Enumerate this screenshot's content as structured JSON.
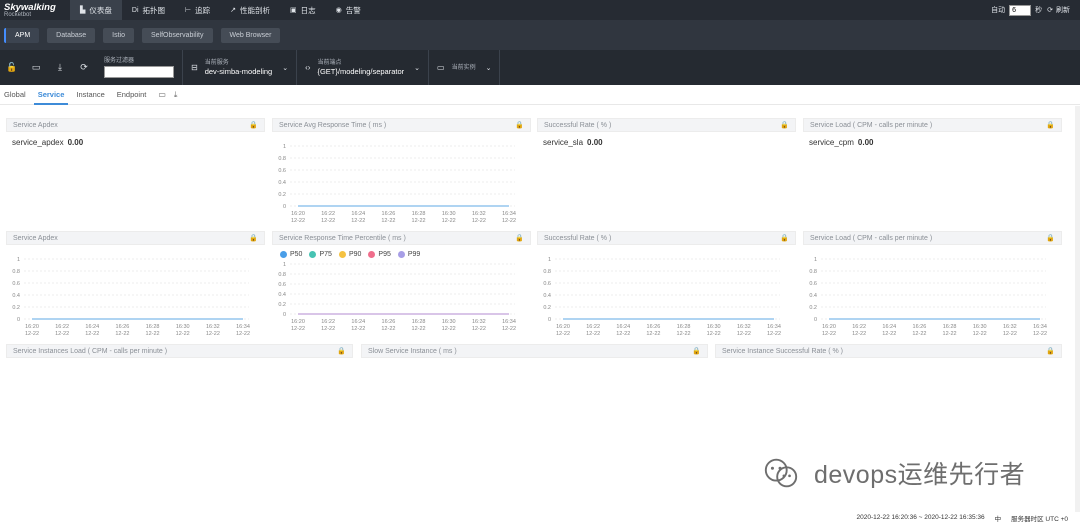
{
  "logo": {
    "line1": "Skywalking",
    "line2": "Rocketbot"
  },
  "nav": {
    "items": [
      {
        "icon": "▙",
        "label": "仪表盘",
        "active": true
      },
      {
        "icon": "Di",
        "label": "拓扑图",
        "active": false
      },
      {
        "icon": "⊢",
        "label": "追踪",
        "active": false
      },
      {
        "icon": "↗",
        "label": "性能剖析",
        "active": false
      },
      {
        "icon": "▣",
        "label": "日志",
        "active": false
      },
      {
        "icon": "◉",
        "label": "告警",
        "active": false
      }
    ],
    "auto_label": "自动",
    "interval_value": "6",
    "seconds_label": "秒",
    "refresh_label": "刷新"
  },
  "layers": [
    "APM",
    "Database",
    "Istio",
    "SelfObservability",
    "Web Browser"
  ],
  "toolbar": {
    "filter_label": "服务过滤器",
    "service_label": "当前服务",
    "service_value": "dev-simba-modeling",
    "endpoint_label": "当前端点",
    "endpoint_value": "{GET}/modeling/separator",
    "instance_label": "当前实例",
    "instance_value": ""
  },
  "tabs": [
    "Global",
    "Service",
    "Instance",
    "Endpoint"
  ],
  "active_tab": "Service",
  "panels": {
    "r1c1": {
      "title": "Service Apdex",
      "stat_name": "service_apdex",
      "stat_value": "0.00"
    },
    "r1c2": {
      "title": "Service Avg Response Time ( ms )"
    },
    "r1c3": {
      "title": "Successful Rate ( % )",
      "stat_name": "service_sla",
      "stat_value": "0.00"
    },
    "r1c4": {
      "title": "Service Load ( CPM - calls per minute )",
      "stat_name": "service_cpm",
      "stat_value": "0.00"
    },
    "r2c1": {
      "title": "Service Apdex"
    },
    "r2c2": {
      "title": "Service Response Time Percentile ( ms )"
    },
    "r2c3": {
      "title": "Successful Rate ( % )"
    },
    "r2c4": {
      "title": "Service Load ( CPM - calls per minute )"
    },
    "r3c1": {
      "title": "Service Instances Load ( CPM - calls per minute )"
    },
    "r3c2": {
      "title": "Slow Service Instance ( ms )"
    },
    "r3c3": {
      "title": "Service Instance Successful Rate ( % )"
    }
  },
  "chart_data": {
    "type": "line",
    "x_labels": [
      [
        "16:20",
        "12-22"
      ],
      [
        "16:22",
        "12-22"
      ],
      [
        "16:24",
        "12-22"
      ],
      [
        "16:26",
        "12-22"
      ],
      [
        "16:28",
        "12-22"
      ],
      [
        "16:30",
        "12-22"
      ],
      [
        "16:32",
        "12-22"
      ],
      [
        "16:34",
        "12-22"
      ]
    ],
    "y_ticks": [
      "1",
      "0.8",
      "0.6",
      "0.4",
      "0.2",
      "0"
    ],
    "ylim": [
      0,
      1
    ],
    "values": [
      0,
      0,
      0,
      0,
      0,
      0,
      0,
      0
    ],
    "series_color": "#5fa8e6",
    "percentile_legend": [
      {
        "name": "P50",
        "color": "#4a9ee8"
      },
      {
        "name": "P75",
        "color": "#47c3b3"
      },
      {
        "name": "P90",
        "color": "#f5c242"
      },
      {
        "name": "P95",
        "color": "#f06e8c"
      },
      {
        "name": "P99",
        "color": "#a79ee6"
      }
    ],
    "percentile_line_color": "#b38bd1"
  },
  "footer": {
    "time_range": "2020-12-22 16:20:36 ~ 2020-12-22 16:35:36",
    "lang": "中",
    "timezone": "服务器时区 UTC +0"
  },
  "watermark": "devops运维先行者"
}
